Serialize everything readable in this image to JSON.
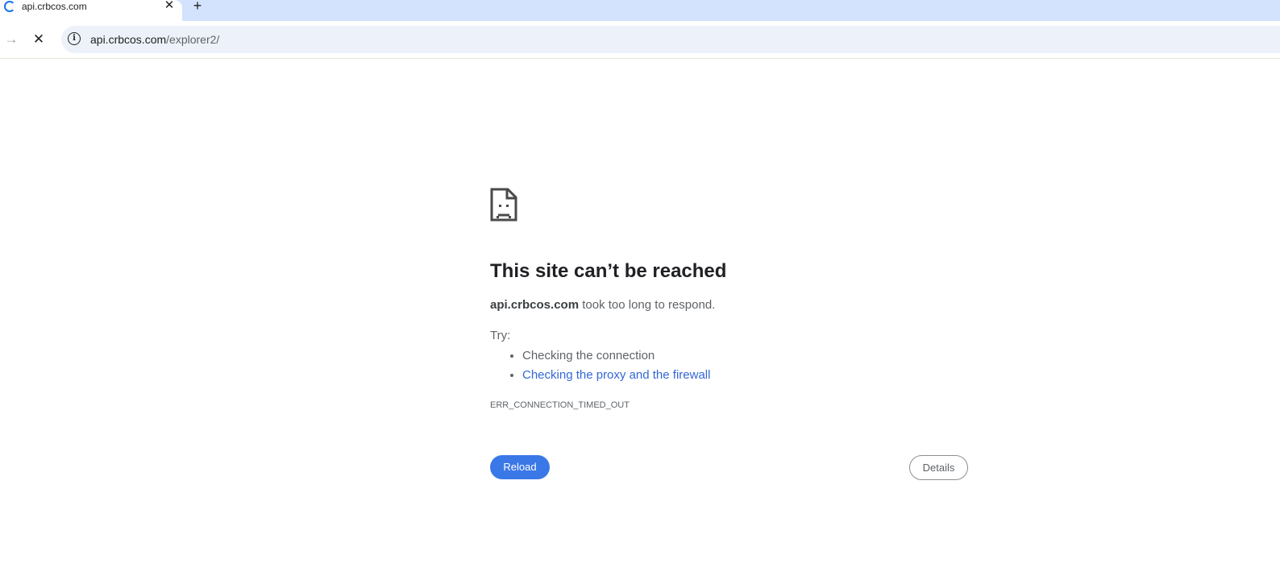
{
  "browser": {
    "tab": {
      "title": "api.crbcos.com",
      "close_glyph": "✕",
      "loading_icon": "spinner-icon"
    },
    "new_tab_glyph": "+",
    "toolbar": {
      "forward_glyph": "→",
      "stop_glyph": "✕",
      "site_info_glyph": "i",
      "url_host": "api.crbcos.com",
      "url_path": "/explorer2/"
    }
  },
  "error_page": {
    "icon": "sad-document-icon",
    "heading": "This site can’t be reached",
    "summary_host": "api.crbcos.com",
    "summary_text": " took too long to respond.",
    "try_label": "Try:",
    "suggestions": [
      {
        "text": "Checking the connection",
        "link": false
      },
      {
        "text": "Checking the proxy and the firewall",
        "link": true
      }
    ],
    "error_code": "ERR_CONNECTION_TIMED_OUT",
    "reload_label": "Reload",
    "details_label": "Details"
  },
  "colors": {
    "tabstrip": "#d3e3fd",
    "omnibox": "#edf2fa",
    "primary_button": "#3b78e7",
    "link": "#3367d6"
  }
}
